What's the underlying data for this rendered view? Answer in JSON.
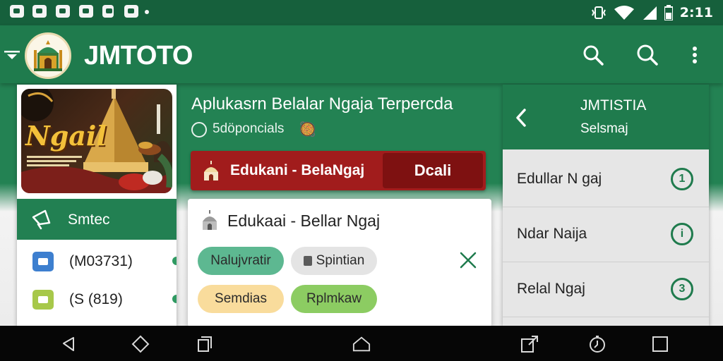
{
  "status_bar": {
    "time": "2:11",
    "left_icons": [
      "notification-icon",
      "notification-icon",
      "image-icon",
      "notification-icon",
      "sim-icon",
      "notification-icon",
      "dot-icon"
    ],
    "right_icons": [
      "vibrate-icon",
      "wifi-icon",
      "signal-icon",
      "battery-icon"
    ]
  },
  "app_bar": {
    "title": "JMTOTO",
    "icons": [
      "filter-icon",
      "mosque-logo-icon",
      "search-icon",
      "search-icon",
      "more-vertical-icon"
    ]
  },
  "left_card": {
    "banner_text": "Ngail",
    "section_label": "Smtec",
    "items": [
      {
        "label": "(M03731)",
        "icon_color": "#3d7fcf"
      },
      {
        "label": "(S (819)",
        "icon_color": "#a7c84a"
      }
    ]
  },
  "center": {
    "title": "Aplukasrn Belalar Ngaja Terpercda",
    "subtitle": "5döponcials",
    "subtitle_emoji": "🥘",
    "highlight_bar": {
      "label": "Edukani - BelaNgaj",
      "button_label": "Dcali"
    },
    "panel": {
      "title": "Edukaai - Bellar Ngaj",
      "chips": [
        {
          "label": "Nalujvratir",
          "color": "#5db891"
        },
        {
          "label": "Spintian",
          "color": "#e4e4e4"
        },
        {
          "label": "Semdias",
          "color": "#f9dc9c"
        },
        {
          "label": "Rplmkaw",
          "color": "#8ccc62"
        }
      ]
    }
  },
  "right_panel": {
    "title": "JMTISTIA",
    "subtitle": "Selsmaj",
    "items": [
      {
        "label": "Edullar N gaj",
        "badge": "1"
      },
      {
        "label": "Ndar Naija",
        "badge": "i"
      },
      {
        "label": "Relal Ngaj",
        "badge": "3"
      }
    ]
  },
  "nav_bar": {
    "icons": [
      "back-icon",
      "diamond-icon",
      "copy-icon",
      "home-icon",
      "expand-icon",
      "timer-icon",
      "recents-icon"
    ]
  },
  "colors": {
    "primary": "#1f7b4d",
    "status_bar": "#16603c",
    "accent_red": "#a11c1c",
    "accent_red_dark": "#7e1111"
  }
}
